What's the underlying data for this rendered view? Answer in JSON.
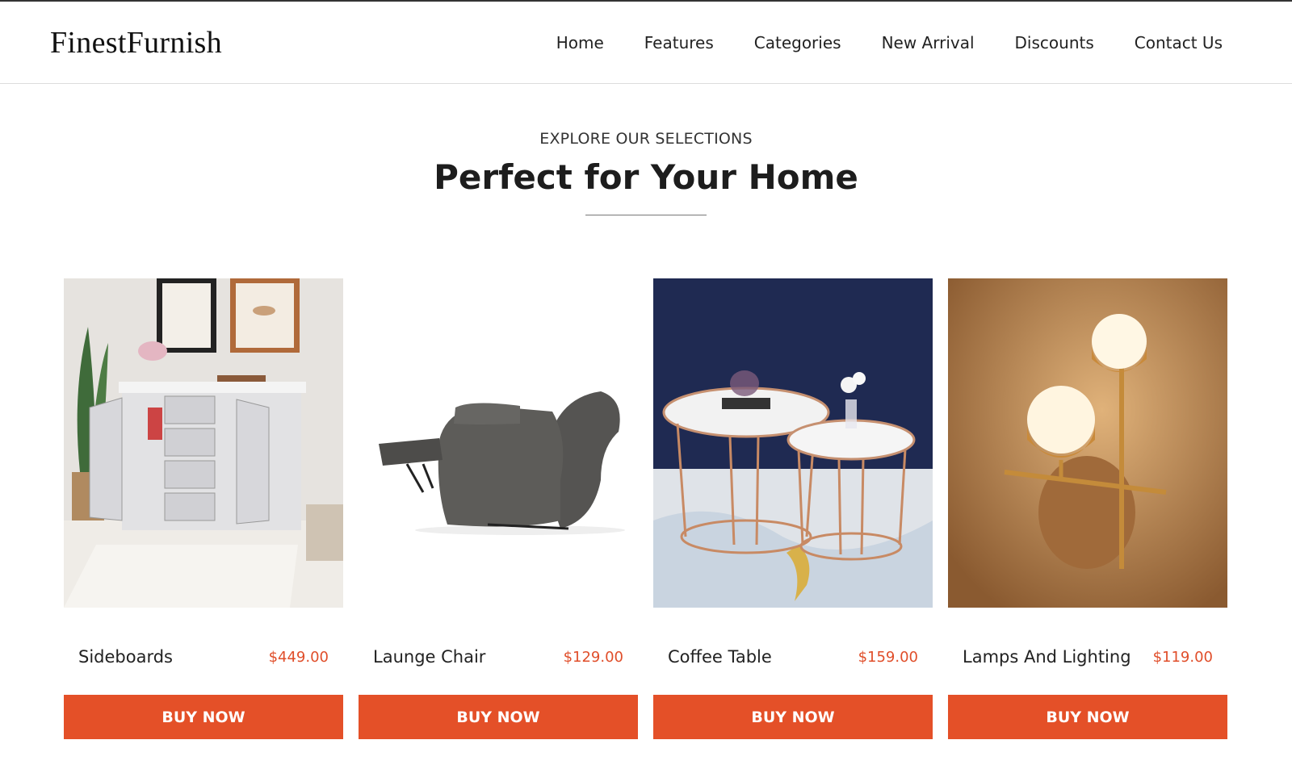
{
  "brand": "FinestFurnish",
  "nav": [
    "Home",
    "Features",
    "Categories",
    "New Arrival",
    "Discounts",
    "Contact Us"
  ],
  "section": {
    "eyebrow": "EXPLORE OUR SELECTIONS",
    "title": "Perfect for Your Home"
  },
  "products": [
    {
      "name": "Sideboards",
      "price": "$449.00",
      "button": "BUY NOW"
    },
    {
      "name": "Launge Chair",
      "price": "$129.00",
      "button": "BUY NOW"
    },
    {
      "name": "Coffee Table",
      "price": "$159.00",
      "button": "BUY NOW"
    },
    {
      "name": "Lamps And Lighting",
      "price": "$119.00",
      "button": "BUY NOW"
    }
  ],
  "colors": {
    "accent": "#e45028",
    "price": "#e04e2a"
  }
}
